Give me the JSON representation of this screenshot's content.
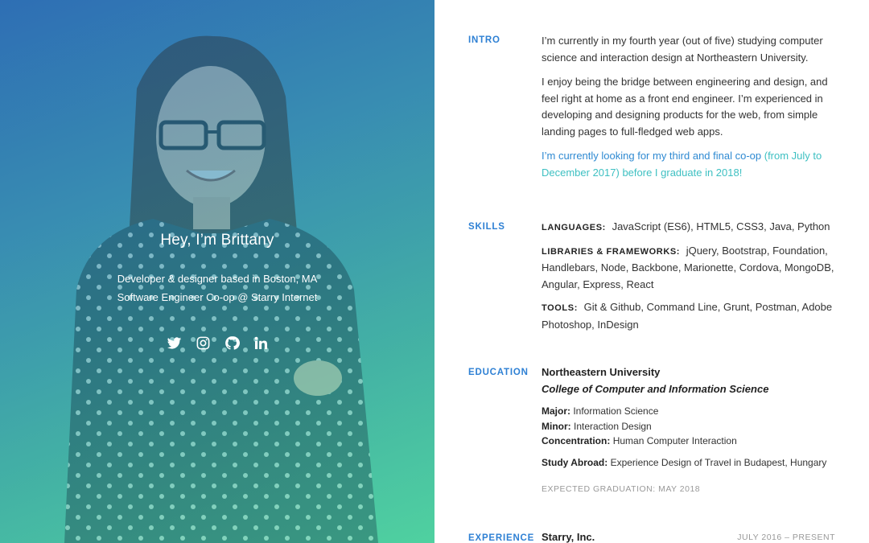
{
  "hero": {
    "greeting": "Hey, I’m Brittany",
    "subtitle_line1": "Developer & designer based in Boston, MA",
    "subtitle_line2": "Software Engineer Co-op @ Starry Internet",
    "social_icons": [
      "twitter-icon",
      "instagram-icon",
      "github-icon",
      "linkedin-icon"
    ],
    "gradient_start": "#2f6fb4",
    "gradient_end": "#4fd0a0"
  },
  "intro": {
    "label": "INTRO",
    "para1": "I’m currently in my fourth year (out of five) studying computer science and interaction design at Northeastern University.",
    "para2": "I enjoy being the bridge between engineering and design, and feel right at home as a front end engineer. I’m experienced in developing and designing products for the web, from simple landing pages to full-fledged web apps.",
    "highlight_part1": "I’m currently looking for my third and final co-op ",
    "highlight_part2": "(from July to December 2017) before I graduate in 2018!"
  },
  "skills": {
    "label": "SKILLS",
    "languages_key": "LANGUAGES:",
    "languages_value": "JavaScript (ES6), HTML5, CSS3, Java, Python",
    "libraries_key": "LIBRARIES & FRAMEWORKS:",
    "libraries_value": "jQuery, Bootstrap, Foundation, Handlebars, Node, Backbone, Marionette, Cordova, MongoDB, Angular, Express, React",
    "tools_key": "TOOLS:",
    "tools_value": "Git & Github, Command Line, Grunt, Postman, Adobe Photoshop, InDesign"
  },
  "education": {
    "label": "EDUCATION",
    "school": "Northeastern University",
    "college": "College of Computer and Information Science",
    "major_key": "Major:",
    "major_value": "Information Science",
    "minor_key": "Minor:",
    "minor_value": "Interaction Design",
    "concentration_key": "Concentration:",
    "concentration_value": "Human Computer Interaction",
    "abroad_key": "Study Abroad:",
    "abroad_value": "Experience Design of Travel in Budapest, Hungary",
    "graduation": "EXPECTED GRADUATION: MAY 2018"
  },
  "experience": {
    "label": "EXPERIENCE",
    "company": "Starry, Inc.",
    "dates": "JULY 2016 – PRESENT"
  },
  "colors": {
    "accent": "#2e80d4",
    "highlight_teal": "#3ec0c2"
  }
}
